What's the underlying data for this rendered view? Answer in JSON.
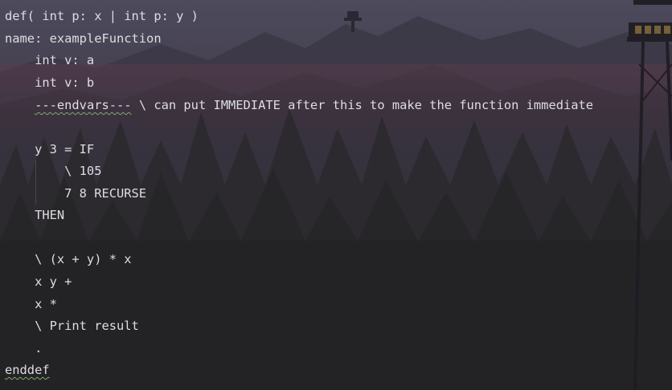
{
  "editor": {
    "line_def_prefix": "def( int p: x | int p: ",
    "line_def_y": "y",
    "line_def_suffix": " )",
    "line_name": "name: exampleFunction",
    "line_var_a": "    int v: a",
    "line_var_b": "    int v: b",
    "line_endvars_indent": "    ",
    "line_endvars_keyword": "---endvars---",
    "line_endvars_comment": " \\ can put IMMEDIATE after this to make the function immediate",
    "line_if": "    y 3 = IF",
    "line_comment_105": "        \\ 105",
    "line_recurse": "        7 8 RECURSE",
    "line_then": "    THEN",
    "line_comment_expr": "    \\ (x + y) * x",
    "line_xy_plus": "    x y +",
    "line_x_times": "    x *",
    "line_comment_print": "    \\ Print result",
    "line_dot": "    .",
    "line_enddef": "enddef"
  },
  "colors": {
    "text": "#dedee2",
    "squiggle": "#7fa86a",
    "sky_top": "#4a4658",
    "forest_dark": "#232326"
  }
}
